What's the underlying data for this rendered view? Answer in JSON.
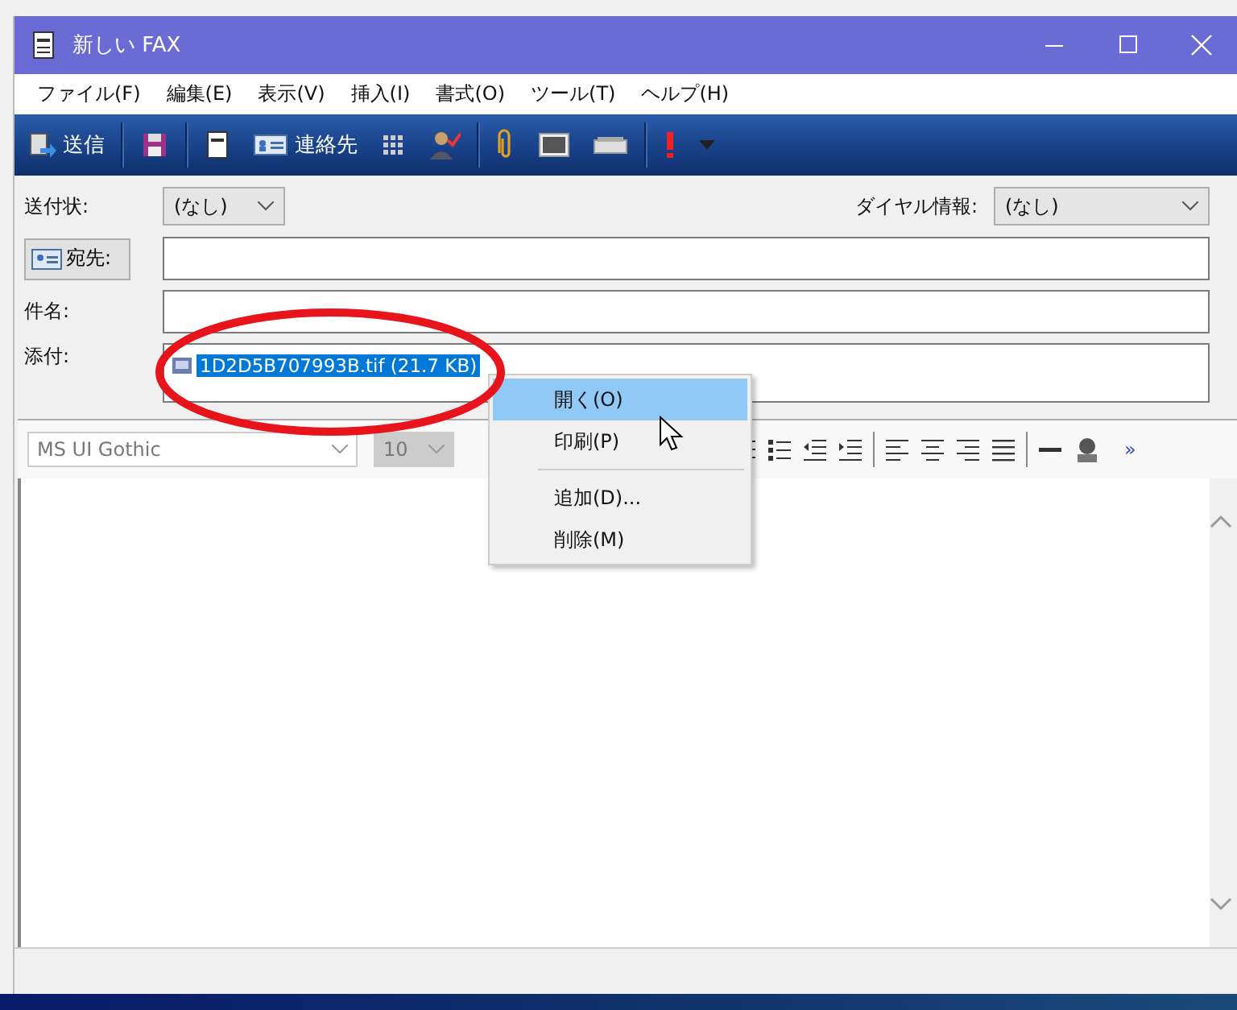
{
  "window": {
    "title": "新しい FAX"
  },
  "menu": [
    "ファイル(F)",
    "編集(E)",
    "表示(V)",
    "挿入(I)",
    "書式(O)",
    "ツール(T)",
    "ヘルプ(H)"
  ],
  "toolbar": {
    "send_label": "送信",
    "contacts_label": "連絡先"
  },
  "form": {
    "cover_label": "送付状:",
    "cover_value": "(なし)",
    "dial_label": "ダイヤル情報:",
    "dial_value": "(なし)",
    "to_label": "宛先:",
    "subject_label": "件名:",
    "attach_label": "添付:",
    "attachment": "1D2D5B707993B.tif (21.7 KB)",
    "attachment_selected": true
  },
  "format_bar": {
    "font": "MS UI Gothic",
    "size": "10",
    "disabled": true,
    "more": "»"
  },
  "context_menu": [
    {
      "label": "開く(O)",
      "selected": true,
      "separator_before": false
    },
    {
      "label": "印刷(P)",
      "selected": false,
      "separator_before": false
    },
    {
      "label": "追加(D)...",
      "selected": false,
      "separator_before": true
    },
    {
      "label": "削除(M)",
      "selected": false,
      "separator_before": false
    }
  ]
}
